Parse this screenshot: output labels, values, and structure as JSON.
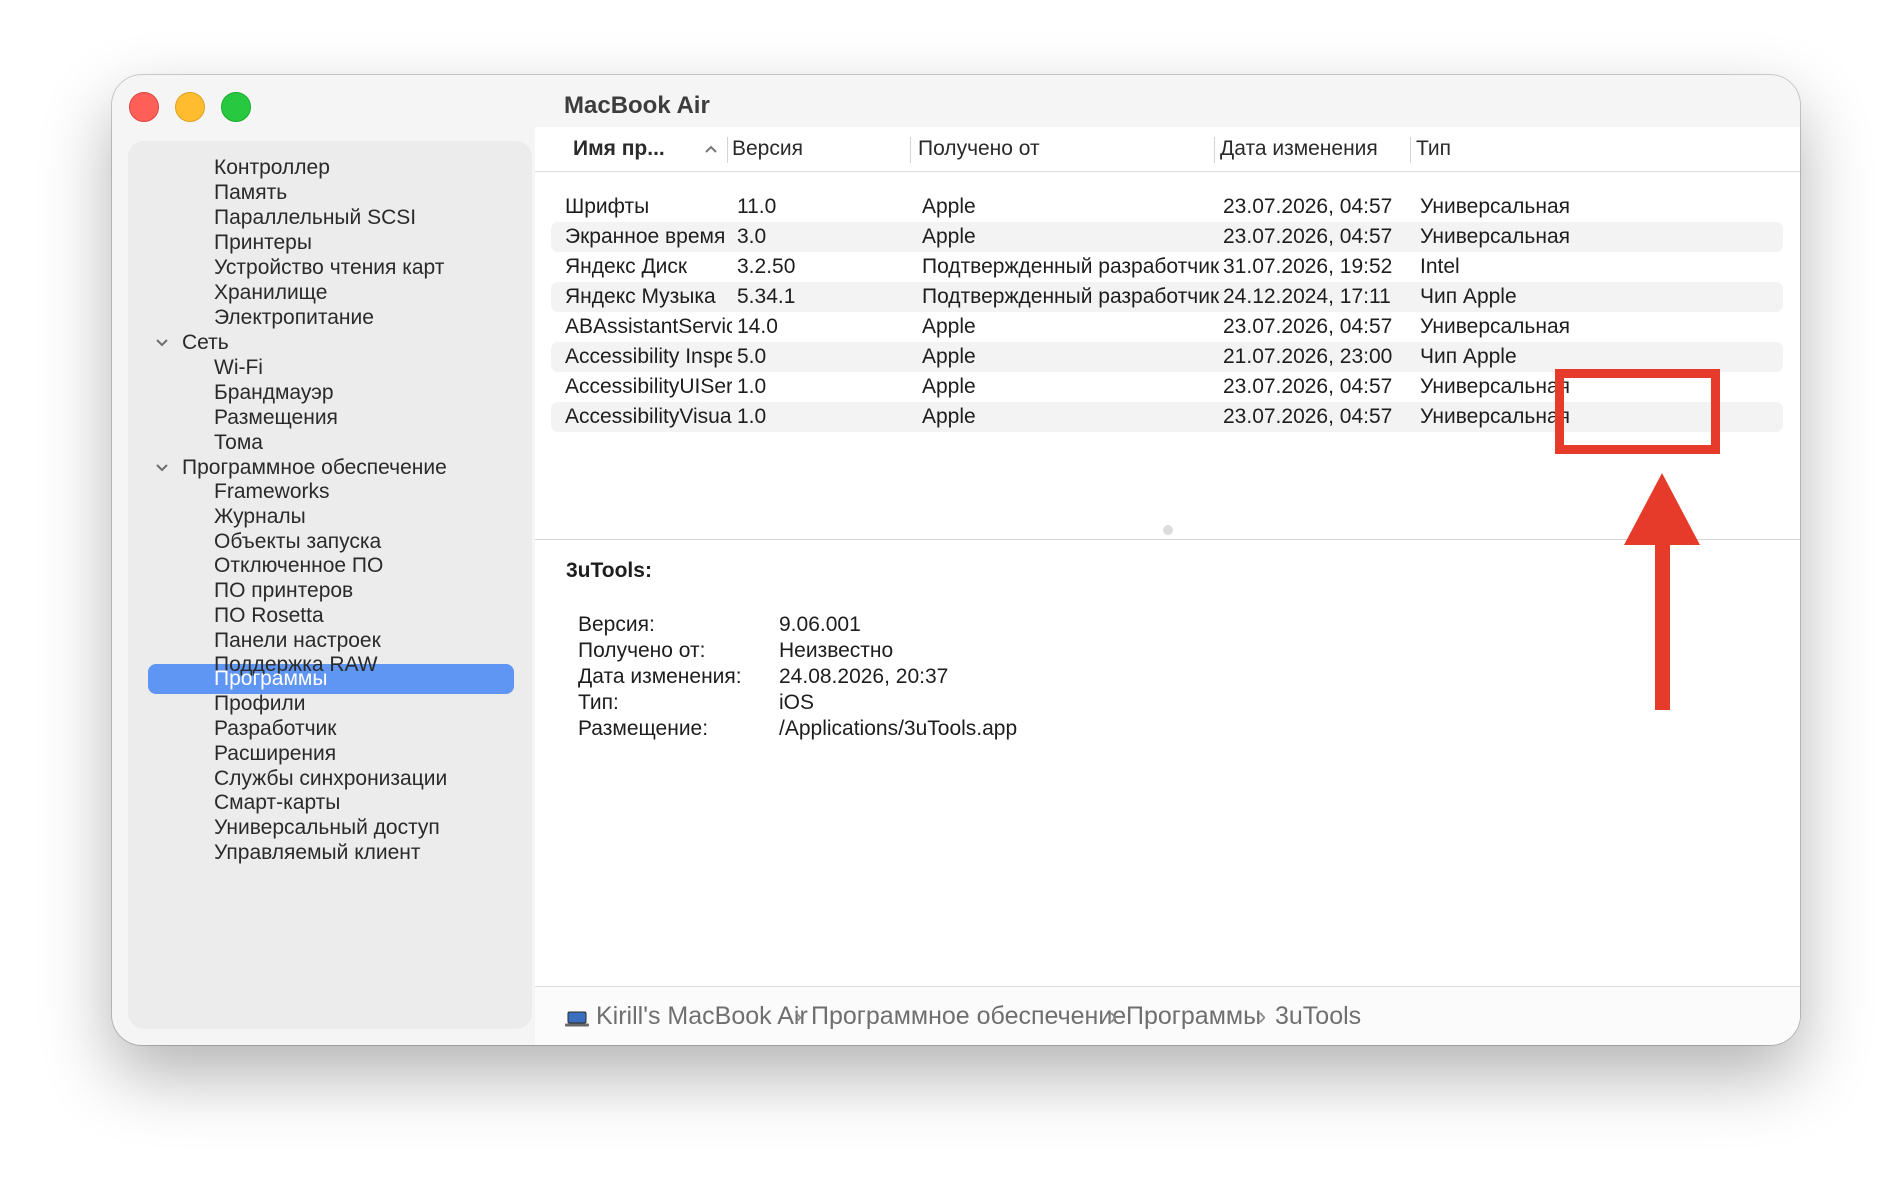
{
  "window": {
    "title": "MacBook Air"
  },
  "sidebar": {
    "items": [
      {
        "label": "Контроллер",
        "level": "sub"
      },
      {
        "label": "Память",
        "level": "sub"
      },
      {
        "label": "Параллельный SCSI",
        "level": "sub"
      },
      {
        "label": "Принтеры",
        "level": "sub"
      },
      {
        "label": "Устройство чтения карт",
        "level": "sub"
      },
      {
        "label": "Хранилище",
        "level": "sub"
      },
      {
        "label": "Электропитание",
        "level": "sub"
      },
      {
        "label": "Сеть",
        "level": "group"
      },
      {
        "label": "Wi-Fi",
        "level": "sub"
      },
      {
        "label": "Брандмауэр",
        "level": "sub"
      },
      {
        "label": "Размещения",
        "level": "sub"
      },
      {
        "label": "Тома",
        "level": "sub"
      },
      {
        "label": "Программное обеспечение",
        "level": "group"
      },
      {
        "label": "Frameworks",
        "level": "sub"
      },
      {
        "label": "Журналы",
        "level": "sub"
      },
      {
        "label": "Объекты запуска",
        "level": "sub"
      },
      {
        "label": "Отключенное ПО",
        "level": "sub"
      },
      {
        "label": "ПО принтеров",
        "level": "sub"
      },
      {
        "label": "ПО Rosetta",
        "level": "sub"
      },
      {
        "label": "Панели настроек",
        "level": "sub"
      },
      {
        "label": "Поддержка RAW",
        "level": "sub"
      },
      {
        "label": "Программы",
        "level": "sub",
        "selected": true
      },
      {
        "label": "Профили",
        "level": "sub"
      },
      {
        "label": "Разработчик",
        "level": "sub"
      },
      {
        "label": "Расширения",
        "level": "sub"
      },
      {
        "label": "Службы синхронизации",
        "level": "sub"
      },
      {
        "label": "Смарт-карты",
        "level": "sub"
      },
      {
        "label": "Универсальный доступ",
        "level": "sub"
      },
      {
        "label": "Управляемый клиент",
        "level": "sub"
      }
    ]
  },
  "table": {
    "columns": [
      "Имя пр...",
      "Версия",
      "Получено от",
      "Дата изменения",
      "Тип"
    ],
    "sort_indicator": "^",
    "rows": [
      [
        "Шрифты",
        "11.0",
        "Apple",
        "23.07.2026, 04:57",
        "Универсальная"
      ],
      [
        "Экранное время",
        "3.0",
        "Apple",
        "23.07.2026, 04:57",
        "Универсальная"
      ],
      [
        "Яндекс Диск",
        "3.2.50",
        "Подтвержденный разработчик",
        "31.07.2026, 19:52",
        "Intel"
      ],
      [
        "Яндекс Музыка",
        "5.34.1",
        "Подтвержденный разработчик",
        "24.12.2024, 17:11",
        "Чип Apple"
      ],
      [
        "ABAssistantService",
        "14.0",
        "Apple",
        "23.07.2026, 04:57",
        "Универсальная"
      ],
      [
        "Accessibility Inspector",
        "5.0",
        "Apple",
        "21.07.2026, 23:00",
        "Чип Apple"
      ],
      [
        "AccessibilityUIServer",
        "1.0",
        "Apple",
        "23.07.2026, 04:57",
        "Универсальная"
      ],
      [
        "AccessibilityVisualsAgent",
        "1.0",
        "Apple",
        "23.07.2026, 04:57",
        "Универсальная"
      ]
    ]
  },
  "detail": {
    "title": "3uTools:",
    "fields": [
      {
        "label": "Версия:",
        "value": "9.06.001"
      },
      {
        "label": "Получено от:",
        "value": "Неизвестно"
      },
      {
        "label": "Дата изменения:",
        "value": "24.08.2026, 20:37"
      },
      {
        "label": "Тип:",
        "value": "iOS"
      },
      {
        "label": "Размещение:",
        "value": "/Applications/3uTools.app"
      }
    ]
  },
  "pathbar": {
    "icon": "laptop-icon",
    "items": [
      "Kirill's MacBook Air",
      "Программное обеспечение",
      "Программы",
      "3uTools"
    ],
    "separator": "›"
  },
  "colors": {
    "accent_selected": "#5f96f3",
    "annotation_red": "#e63a2a",
    "close": "#fe5f57",
    "minimize": "#febc2e",
    "maximize": "#28c840"
  }
}
